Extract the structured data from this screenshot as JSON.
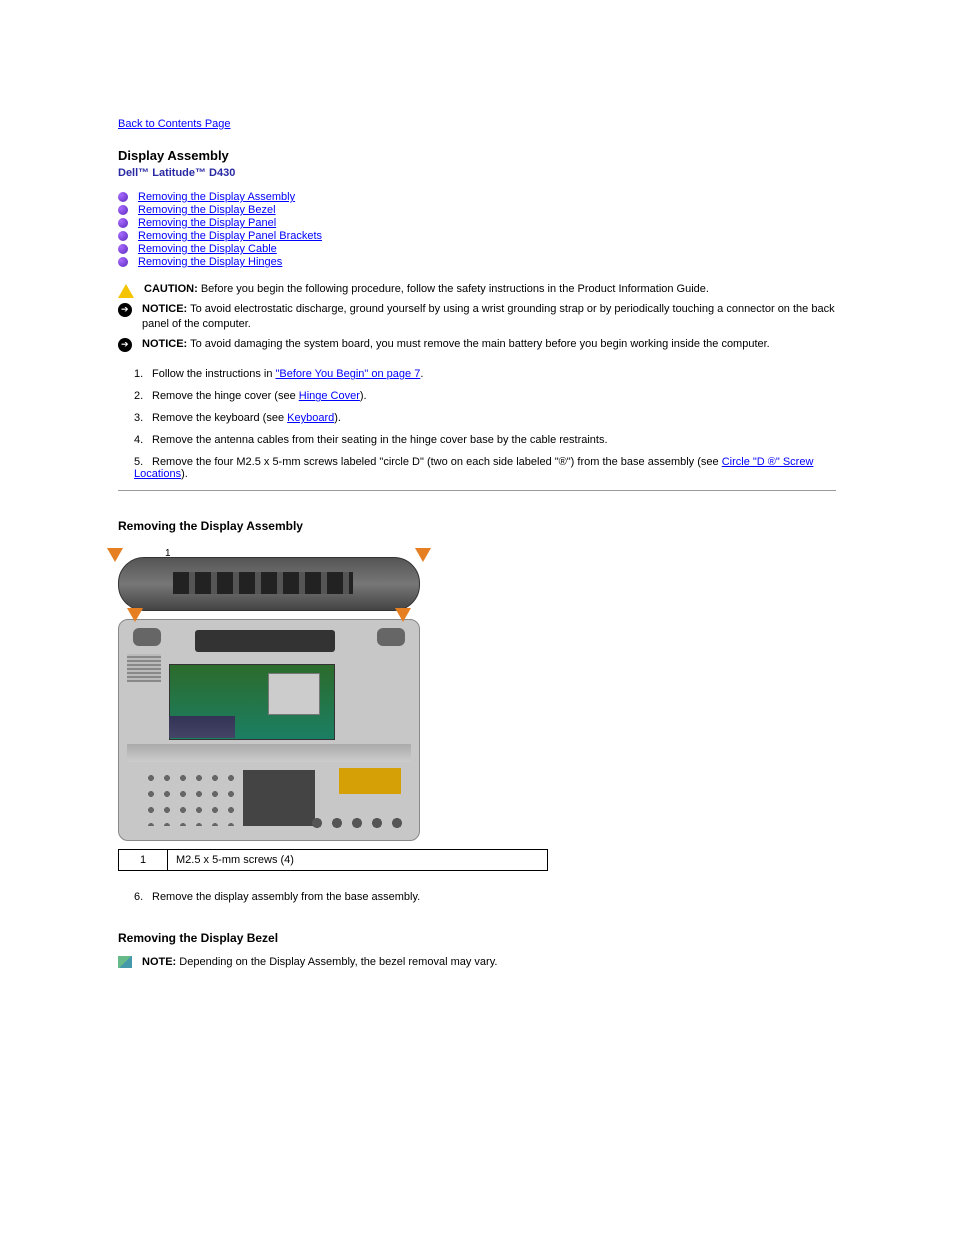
{
  "back_link": "Back to Contents Page",
  "section_title": "Display Assembly",
  "product": "Dell™ Latitude™ D430",
  "toc": [
    "Removing the Display Assembly",
    "Removing the Display Bezel",
    "Removing the Display Panel",
    "Removing the Display Panel Brackets",
    "Removing the Display Cable",
    "Removing the Display Hinges"
  ],
  "alerts": {
    "caution": {
      "label": "CAUTION:",
      "text": "Before you begin the following procedure, follow the safety instructions in the Product Information Guide."
    },
    "notice1": {
      "label": "NOTICE:",
      "text": "To avoid electrostatic discharge, ground yourself by using a wrist grounding strap or by periodically touching a connector on the back panel of the computer."
    },
    "notice2": {
      "label": "NOTICE:",
      "text": "To avoid damaging the system board, you must remove the main battery before you begin working inside the computer."
    }
  },
  "procedure": [
    {
      "n": "1.",
      "text_a": "Follow the instructions in ",
      "link": "\"Before You Begin\" on page 7",
      "text_b": "."
    },
    {
      "n": "2.",
      "text_a": "Remove the hinge cover (see ",
      "link": "Hinge Cover",
      "text_b": ")."
    },
    {
      "n": "3.",
      "text_a": "Remove the keyboard (see ",
      "link": "Keyboard",
      "text_b": ")."
    },
    {
      "n": "4.",
      "text_a": "Remove the antenna cables from their seating in the hinge cover base by the cable restraints.",
      "link": "",
      "text_b": ""
    },
    {
      "n": "5.",
      "text_a": "Remove the four M2.5 x 5-mm screws labeled \"circle D\" (two on each side labeled \"",
      "circle": "®",
      "text_mid": "\") from the base assembly (see ",
      "link": "Circle \"D ®\" Screw Locations",
      "text_b": ")."
    }
  ],
  "sub1": {
    "heading": "Removing the Display Assembly",
    "lead": "1",
    "callout_n": "1",
    "callout_text": "M2.5 x 5-mm screws (4)"
  },
  "step6": {
    "n": "6.",
    "text": "Remove the display assembly from the base assembly."
  },
  "sub2": {
    "heading": "Removing the Display Bezel",
    "note": {
      "label": "NOTE:",
      "text": "Depending on the Display Assembly, the bezel removal may vary."
    }
  }
}
